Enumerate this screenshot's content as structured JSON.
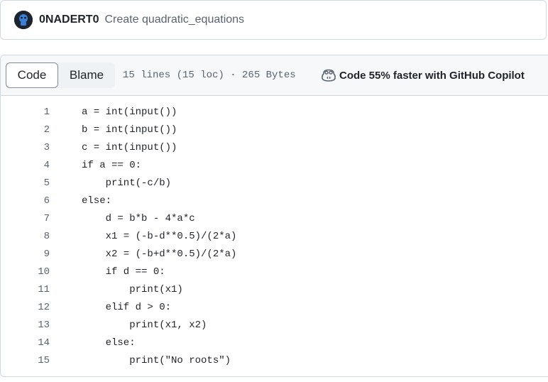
{
  "commit": {
    "author": "0NADERT0",
    "message": "Create quadratic_equations"
  },
  "file_header": {
    "tabs": [
      {
        "label": "Code",
        "active": true
      },
      {
        "label": "Blame",
        "active": false
      }
    ],
    "info": "15 lines (15 loc) · 265 Bytes",
    "copilot_label": "Code 55% faster with GitHub Copilot"
  },
  "code": {
    "lines": [
      {
        "number": "1",
        "text": "a = int(input())"
      },
      {
        "number": "2",
        "text": "b = int(input())"
      },
      {
        "number": "3",
        "text": "c = int(input())"
      },
      {
        "number": "4",
        "text": "if a == 0:"
      },
      {
        "number": "5",
        "text": "    print(-c/b)"
      },
      {
        "number": "6",
        "text": "else:"
      },
      {
        "number": "7",
        "text": "    d = b*b - 4*a*c"
      },
      {
        "number": "8",
        "text": "    x1 = (-b-d**0.5)/(2*a)"
      },
      {
        "number": "9",
        "text": "    x2 = (-b+d**0.5)/(2*a)"
      },
      {
        "number": "10",
        "text": "    if d == 0:"
      },
      {
        "number": "11",
        "text": "        print(x1)"
      },
      {
        "number": "12",
        "text": "    elif d > 0:"
      },
      {
        "number": "13",
        "text": "        print(x1, x2)"
      },
      {
        "number": "14",
        "text": "    else:"
      },
      {
        "number": "15",
        "text": "        print(\"No roots\")"
      }
    ]
  },
  "colors": {
    "border": "#d1d9e0",
    "header_bg": "#f6f8fa",
    "muted_text": "#59636e",
    "text": "#1f2328"
  },
  "icons": {
    "avatar": "user-avatar",
    "copilot": "copilot-icon"
  }
}
